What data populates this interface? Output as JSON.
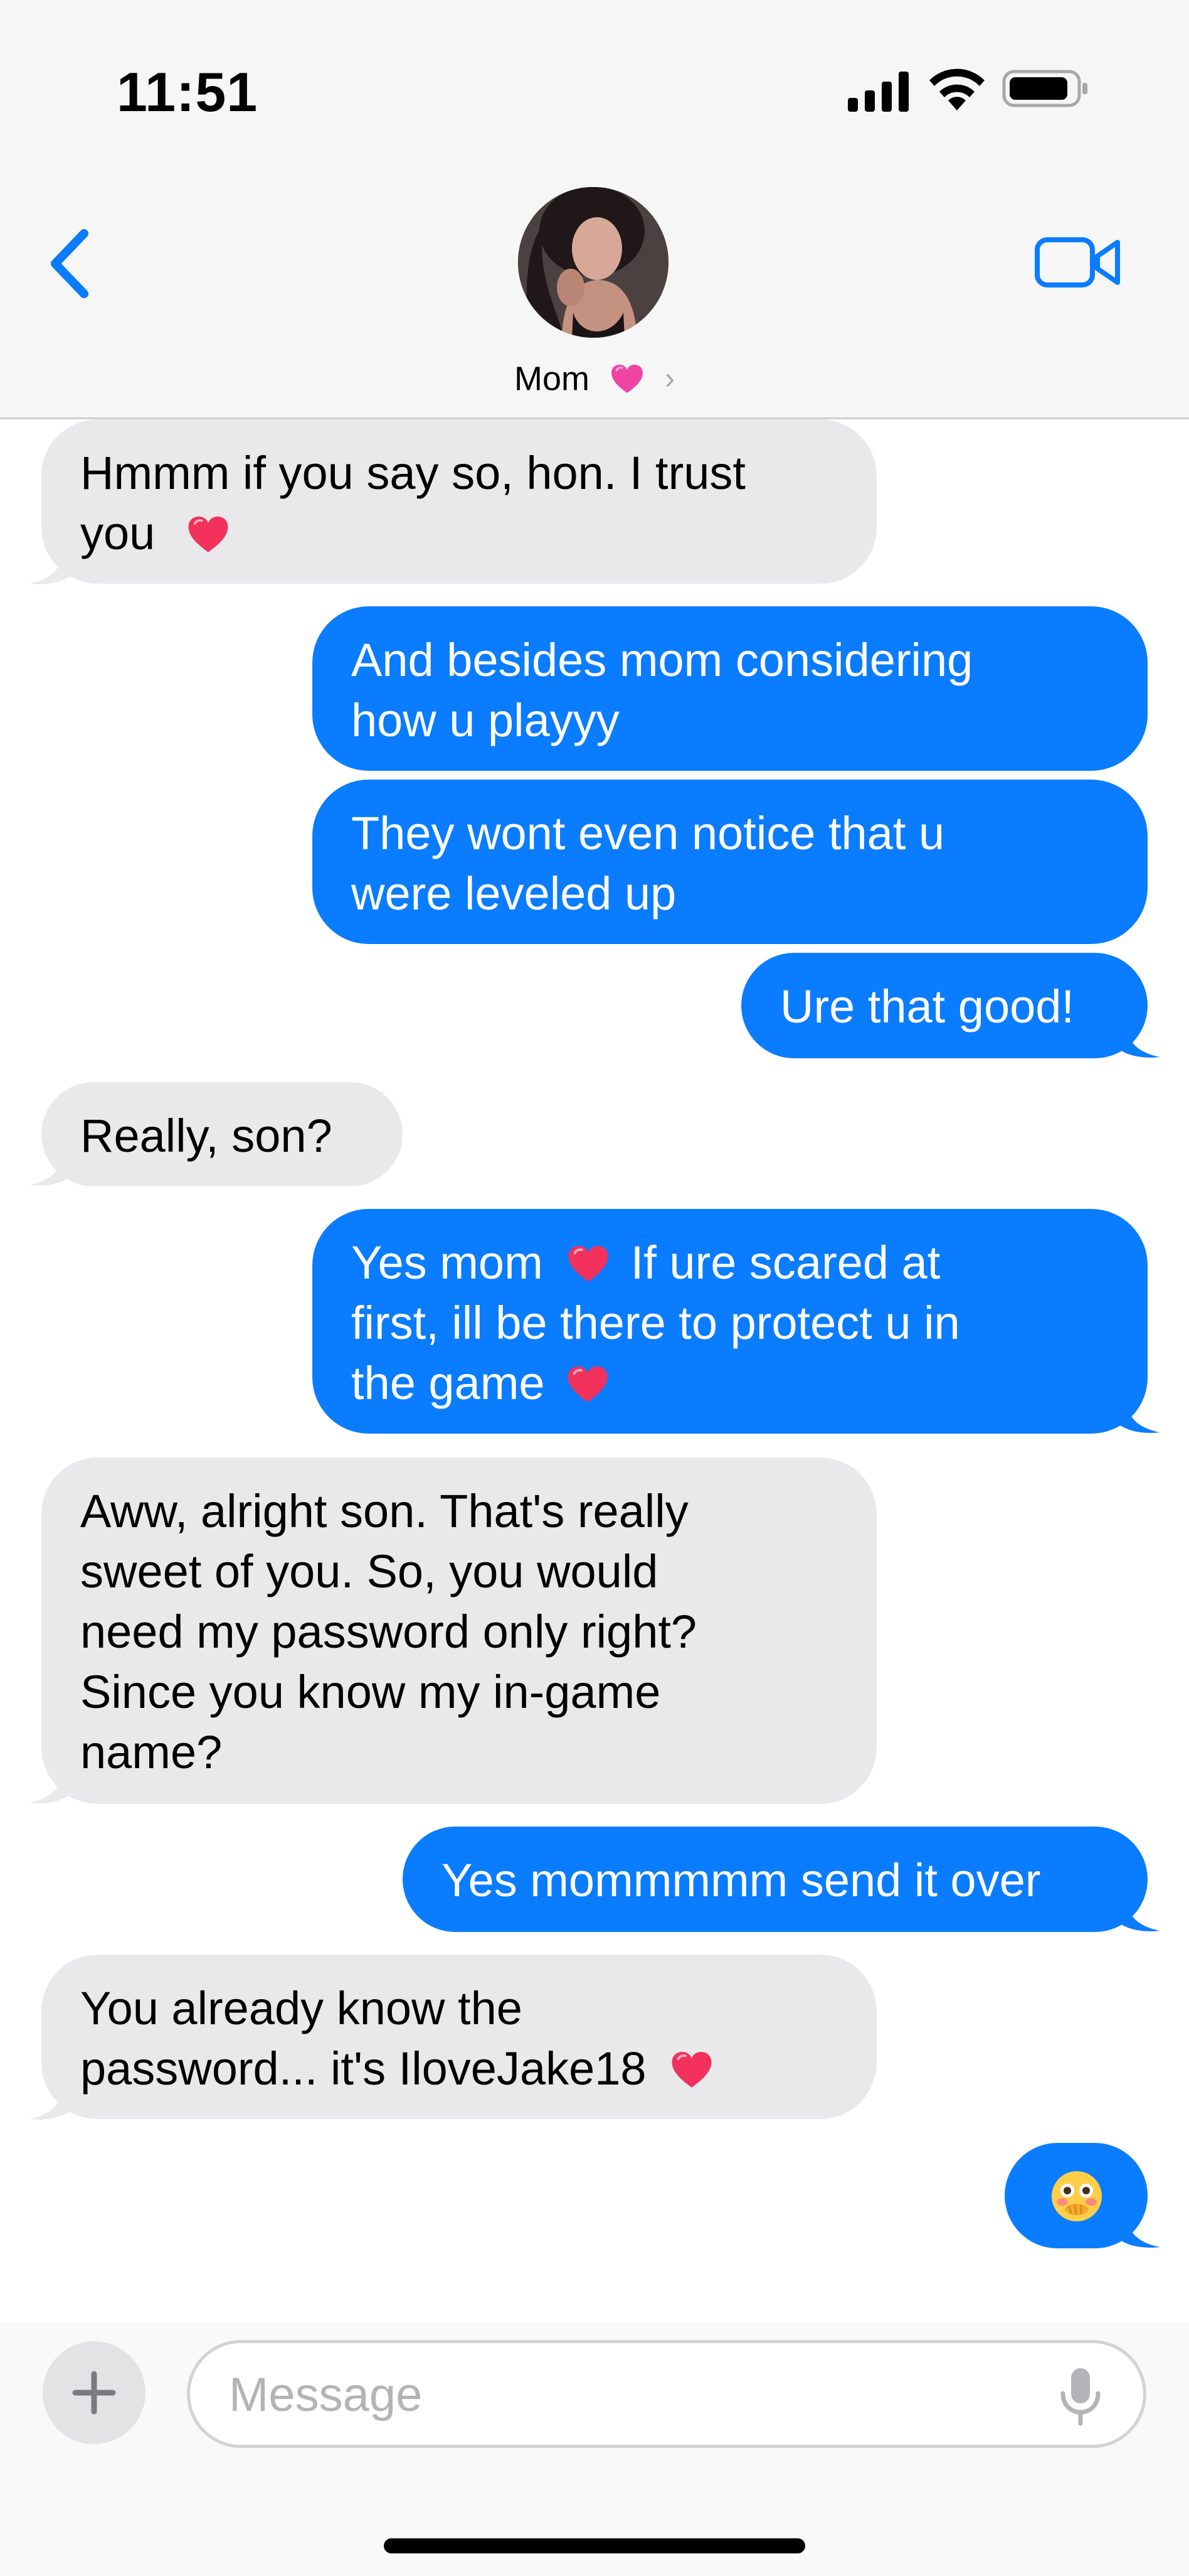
{
  "status_bar": {
    "time": "11:51"
  },
  "header": {
    "contact_name": "Mom",
    "back_icon": "chevron-left-icon",
    "video_icon": "video-camera-icon",
    "accent_color": "#0a7cff"
  },
  "messages": [
    {
      "sender": "incoming",
      "lines": [
        "Hmmm if you say so, hon. I trust",
        "you"
      ],
      "emoji_after_line": 1
    },
    {
      "sender": "outgoing",
      "lines": [
        "And besides mom considering",
        "how u playyy"
      ]
    },
    {
      "sender": "outgoing",
      "lines": [
        "They wont even notice that u",
        "were leveled up"
      ]
    },
    {
      "sender": "outgoing",
      "lines": [
        "Ure that good!"
      ]
    },
    {
      "sender": "incoming",
      "lines": [
        "Really, son?"
      ]
    },
    {
      "sender": "outgoing",
      "lines_parts": [
        "Yes mom",
        "If ure scared at",
        "first, ill be there to protect u in",
        "the game"
      ]
    },
    {
      "sender": "incoming",
      "lines": [
        "Aww, alright son. That's really",
        "sweet of you. So, you would",
        "need my password only right?",
        "Since you know my in-game",
        "name?"
      ]
    },
    {
      "sender": "outgoing",
      "lines": [
        "Yes mommmmm send it over"
      ]
    },
    {
      "sender": "incoming",
      "lines": [
        "You already know the",
        "password... it's IloveJake18"
      ]
    },
    {
      "sender": "outgoing",
      "emoji": "flushed-face-hand-over-mouth-emoji"
    }
  ],
  "composer": {
    "placeholder": "Message",
    "plus_icon": "plus-icon",
    "mic_icon": "microphone-icon"
  },
  "colors": {
    "outgoing_bubble": "#0a7cff",
    "incoming_bubble": "#e9e9eb",
    "heart": "#f2315c",
    "pink_heart": "#f043a6"
  }
}
